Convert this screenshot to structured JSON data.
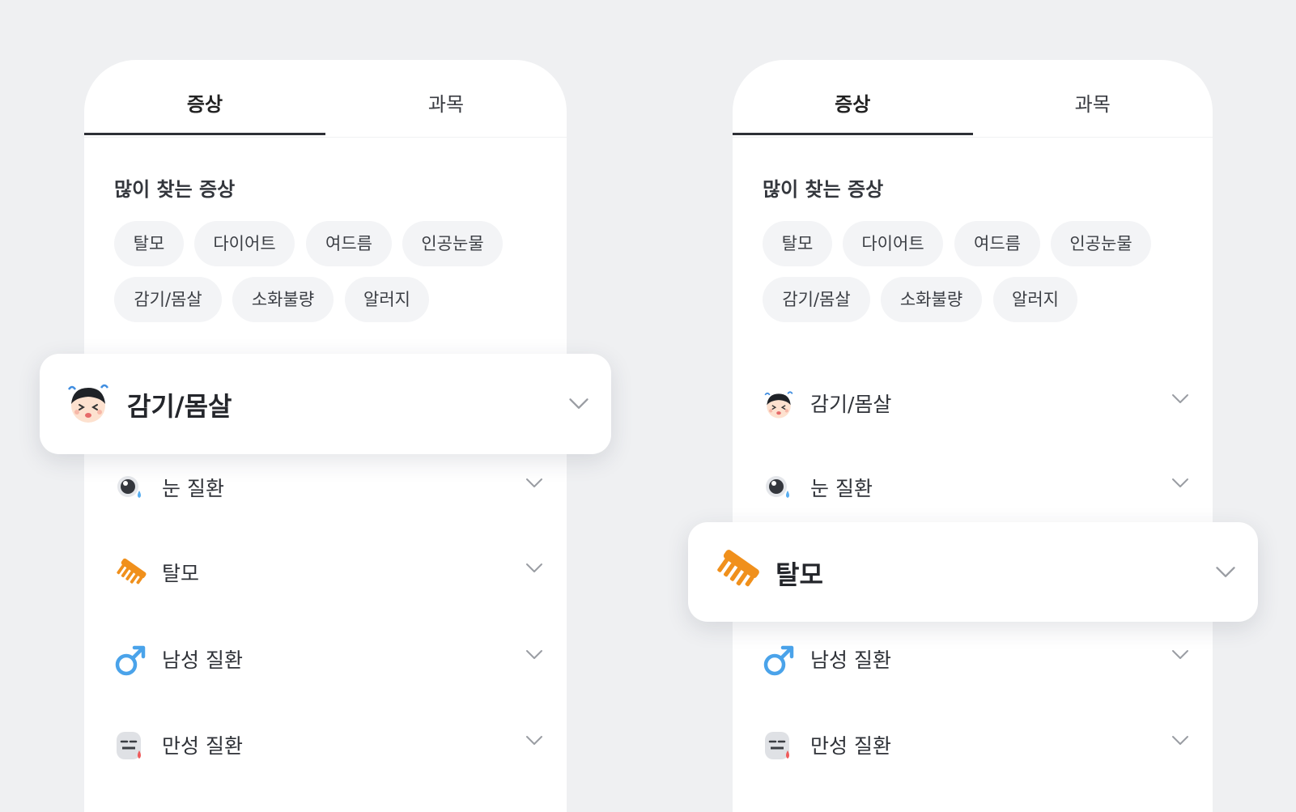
{
  "tabs": [
    "증상",
    "과목"
  ],
  "section_title": "많이 찾는 증상",
  "chips": [
    "탈모",
    "다이어트",
    "여드름",
    "인공눈물",
    "감기/몸살",
    "소화불량",
    "알러지"
  ],
  "categories": [
    {
      "label": "감기/몸살",
      "icon": "sick-face-icon"
    },
    {
      "label": "눈 질환",
      "icon": "eye-drop-icon"
    },
    {
      "label": "탈모",
      "icon": "comb-icon"
    },
    {
      "label": "남성 질환",
      "icon": "male-symbol-icon"
    },
    {
      "label": "만성 질환",
      "icon": "chronic-face-icon"
    }
  ],
  "colors": {
    "background": "#eff0f2",
    "comb": "#f0901c",
    "male": "#4aa3ea",
    "tab_underline": "#2e3036"
  }
}
